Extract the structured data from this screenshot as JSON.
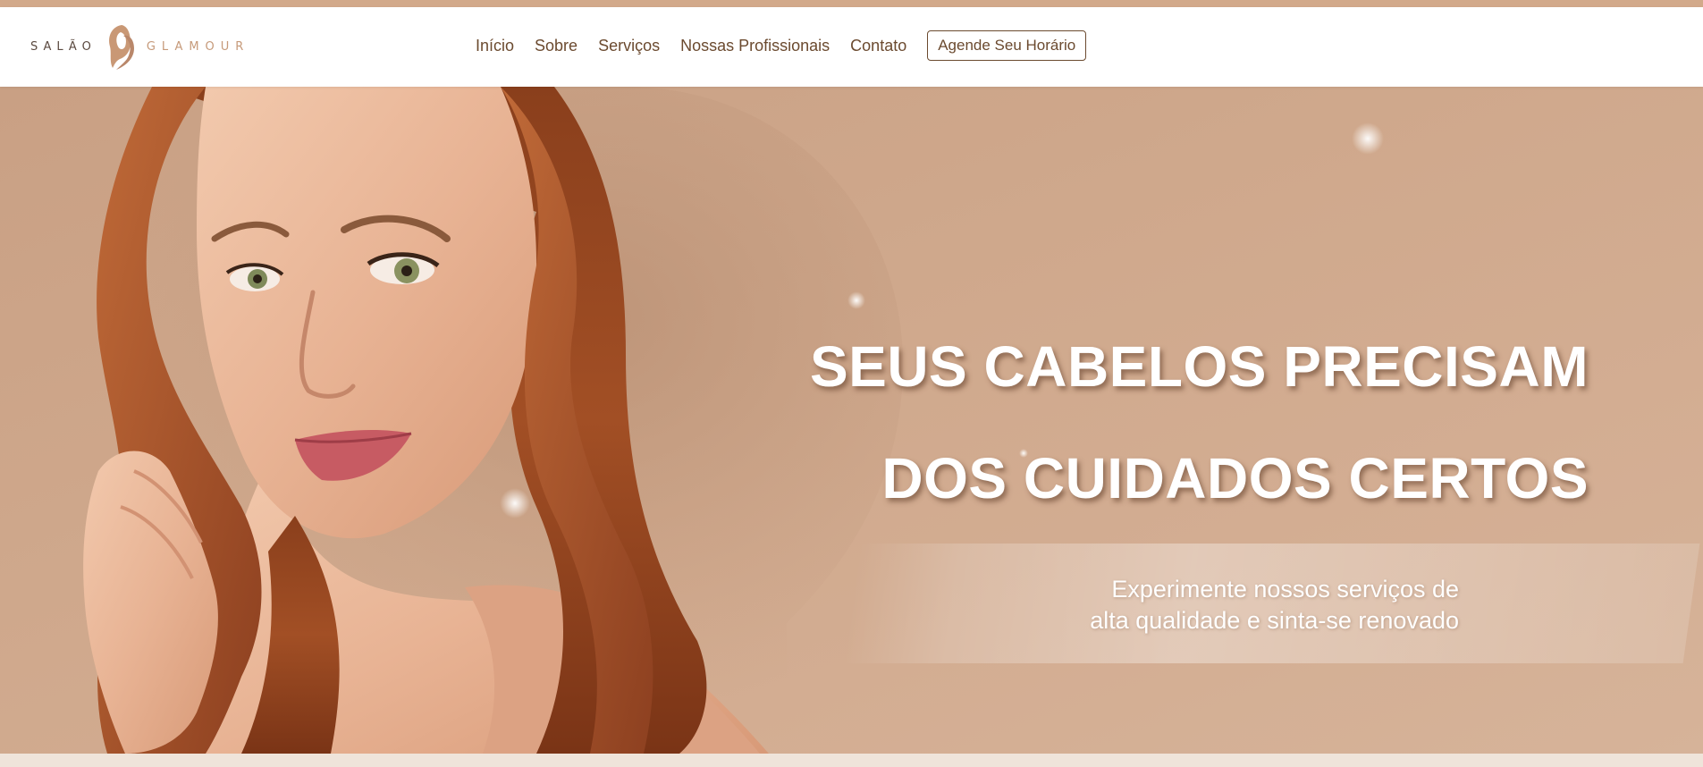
{
  "brand": {
    "word_1": "SALÃO",
    "word_2": "GLAMOUR",
    "logo_icon": "woman-hair-silhouette-icon"
  },
  "nav": {
    "items": [
      {
        "label": "Início"
      },
      {
        "label": "Sobre"
      },
      {
        "label": "Serviços"
      },
      {
        "label": "Nossas Profissionais"
      },
      {
        "label": "Contato"
      }
    ],
    "cta_label": "Agende Seu Horário"
  },
  "hero": {
    "headline_line_1": "SEUS CABELOS PRECISAM",
    "headline_line_2": "DOS CUIDADOS CERTOS",
    "subtitle_line_1": "Experimente nossos serviços de",
    "subtitle_line_2": "alta qualidade e sinta-se renovado",
    "image": "woman-with-wavy-red-hair-portrait"
  },
  "colors": {
    "top_strip": "#d2a98a",
    "nav_text": "#6b4a2f",
    "hero_background": "#cfa88c",
    "headline": "#ffffff",
    "page_background": "#efe4da"
  }
}
